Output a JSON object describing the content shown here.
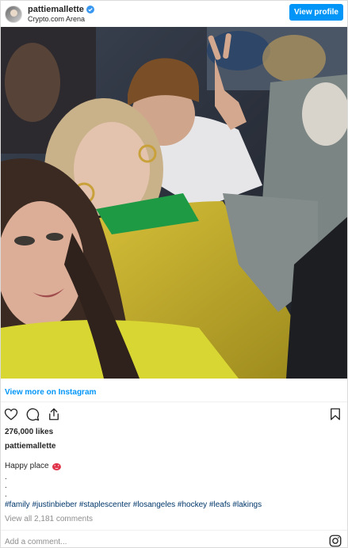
{
  "header": {
    "username": "pattiemallette",
    "location": "Crypto.com Arena",
    "view_profile_label": "View profile",
    "verified_color": "#3897f0"
  },
  "photo": {
    "alt": "Selfie of three people in arena seats",
    "icon": "photo"
  },
  "post": {
    "view_more_label": "View more on Instagram",
    "likes": "276,000 likes",
    "caption_user": "pattiemallette",
    "caption_text": "Happy place",
    "caption_emoji": "heart-eyes-emoji",
    "caption_dots": [
      ".",
      ".",
      "."
    ],
    "hashtags": "#family #justinbieber #staplescenter #losangeles #hockey #leafs #lakings",
    "view_comments": "View all 2,181 comments",
    "add_comment_placeholder": "Add a comment..."
  },
  "icons": {
    "like": "heart-icon",
    "comment": "comment-icon",
    "share": "share-icon",
    "save": "bookmark-icon",
    "instagram": "instagram-icon"
  },
  "colors": {
    "accent": "#0095f6",
    "hashtag": "#00376b",
    "muted": "#8e8e8e"
  }
}
